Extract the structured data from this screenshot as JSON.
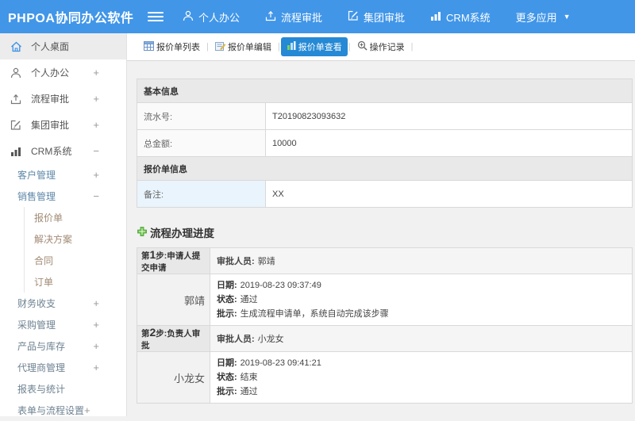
{
  "theme": {
    "topbar_blue": "#4196e8",
    "active_tab_blue": "#2589d5",
    "plus_green": "#5cb85c",
    "remark_label_bg": "#e9f4fc"
  },
  "topbar": {
    "logo": "PHPOA协同办公软件",
    "nav": [
      {
        "label": "个人办公",
        "icon": "user-icon"
      },
      {
        "label": "流程审批",
        "icon": "workflow-icon"
      },
      {
        "label": "集团审批",
        "icon": "edit-icon"
      },
      {
        "label": "CRM系统",
        "icon": "chart-icon"
      },
      {
        "label": "更多应用",
        "icon": "caret-down-icon"
      }
    ]
  },
  "sidebar": {
    "items": [
      {
        "label": "个人桌面",
        "icon": "home-icon",
        "selected": true
      },
      {
        "label": "个人办公",
        "icon": "user-icon",
        "toggle": "+"
      },
      {
        "label": "流程审批",
        "icon": "workflow-icon",
        "toggle": "+"
      },
      {
        "label": "集团审批",
        "icon": "edit-icon",
        "toggle": "+"
      },
      {
        "label": "CRM系统",
        "icon": "chart-icon",
        "toggle": "−"
      },
      {
        "label": "客户管理",
        "toggle": "+"
      },
      {
        "label": "销售管理",
        "toggle": "−"
      },
      {
        "label": "报价单"
      },
      {
        "label": "解决方案"
      },
      {
        "label": "合同"
      },
      {
        "label": "订单"
      },
      {
        "label": "财务收支",
        "toggle": "+"
      },
      {
        "label": "采购管理",
        "toggle": "+"
      },
      {
        "label": "产品与库存",
        "toggle": "+"
      },
      {
        "label": "代理商管理",
        "toggle": "+"
      },
      {
        "label": "报表与统计"
      },
      {
        "label": "表单与流程设置",
        "toggle": "+"
      }
    ]
  },
  "tabs": [
    {
      "label": "报价单列表",
      "icon": "table-icon",
      "active": false
    },
    {
      "label": "报价单编辑",
      "icon": "edit-note-icon",
      "active": false
    },
    {
      "label": "报价单查看",
      "icon": "view-icon",
      "active": true
    },
    {
      "label": "操作记录",
      "icon": "zoom-in-icon",
      "active": false
    }
  ],
  "form": {
    "sections": [
      {
        "header": "基本信息",
        "rows": [
          {
            "label": "流水号:",
            "value": "T20190823093632"
          },
          {
            "label": "总金额:",
            "value": "10000"
          }
        ]
      },
      {
        "header": "报价单信息",
        "rows": [
          {
            "label": "备注:",
            "value": "XX"
          }
        ]
      }
    ]
  },
  "process": {
    "title": "流程办理进度",
    "steps": [
      {
        "step_prefix": "第",
        "step_num": "1",
        "step_suffix": "步:申请人提交申请",
        "approver_label": "审批人员:",
        "approver": "郭靖",
        "name": "郭靖",
        "date_label": "日期:",
        "date": "2019-08-23 09:37:49",
        "status_label": "状态:",
        "status": "通过",
        "comment_label": "批示:",
        "comment": "生成流程申请单，系统自动完成该步骤"
      },
      {
        "step_prefix": "第",
        "step_num": "2",
        "step_suffix": "步:负责人审批",
        "approver_label": "审批人员:",
        "approver": "小龙女",
        "name": "小龙女",
        "date_label": "日期:",
        "date": "2019-08-23 09:41:21",
        "status_label": "状态:",
        "status": "结束",
        "comment_label": "批示:",
        "comment": "通过"
      }
    ]
  }
}
